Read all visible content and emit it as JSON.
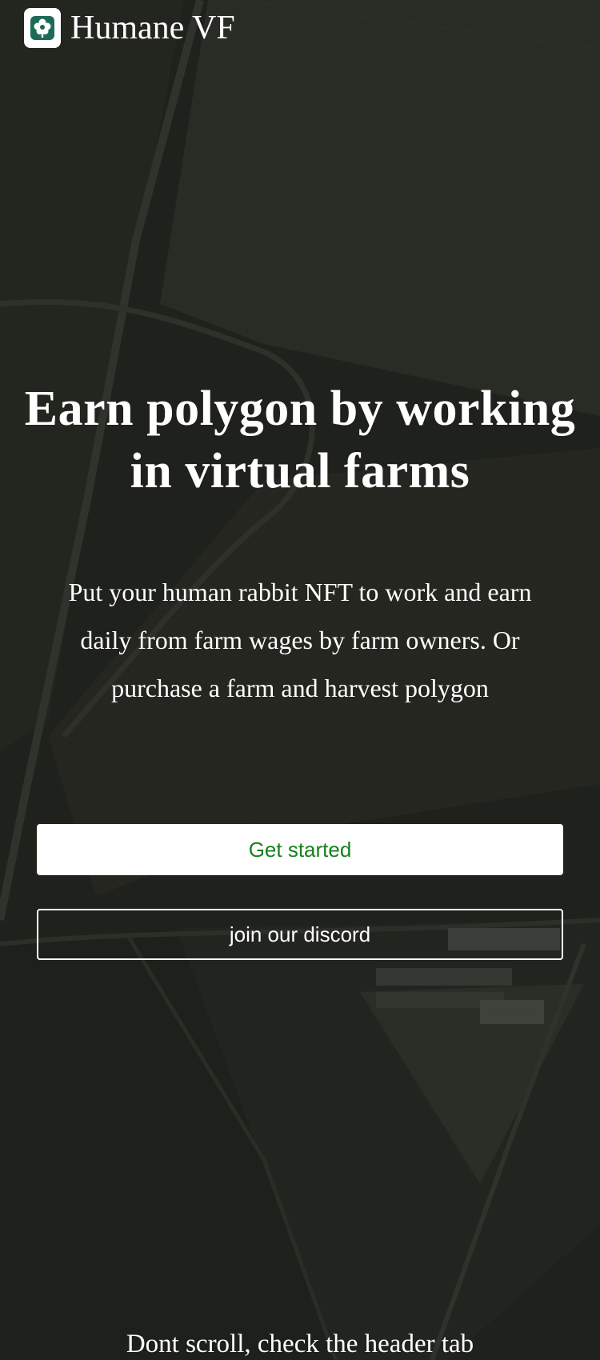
{
  "header": {
    "brand": "Humane VF",
    "logo_icon": "flower-icon"
  },
  "hero": {
    "headline_line1": "Earn polygon by working",
    "headline_line2": "in virtual farms",
    "subtext_line1": "Put your human rabbit NFT to work and earn",
    "subtext_line2": "daily from farm wages by farm owners. Or",
    "subtext_line3": "purchase a farm and harvest polygon"
  },
  "actions": {
    "primary_label": "Get started",
    "secondary_label": "join our discord"
  },
  "footer": {
    "note": "Dont scroll, check the header tab"
  },
  "colors": {
    "accent": "#16801c",
    "logo_green": "#1b6b58",
    "background": "#1d1f1a"
  }
}
